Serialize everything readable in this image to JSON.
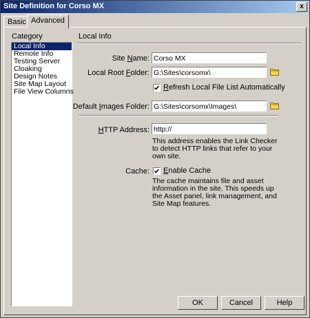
{
  "window": {
    "title": "Site Definition for Corso MX",
    "close_label": "x"
  },
  "tabs": [
    {
      "label": "Basic"
    },
    {
      "label": "Advanced"
    }
  ],
  "category": {
    "label": "Category",
    "items": [
      "Local Info",
      "Remote Info",
      "Testing Server",
      "Cloaking",
      "Design Notes",
      "Site Map Layout",
      "File View Columns"
    ],
    "selected": "Local Info"
  },
  "local_info": {
    "title": "Local Info",
    "site_name": {
      "label": "Site Name:",
      "value": "Corso MX"
    },
    "local_root": {
      "label": "Local Root Folder:",
      "value": "G:\\Sites\\corsomx\\"
    },
    "refresh": {
      "label": "Refresh Local File List Automatically",
      "checked": true
    },
    "images_folder": {
      "label": "Default Images Folder:",
      "value": "G:\\Sites\\corsomx\\Images\\"
    },
    "http_address": {
      "label": "HTTP Address:",
      "value": "http://",
      "description": "This address enables the Link Checker to detect HTTP links that refer to your own site."
    },
    "cache": {
      "label": "Cache:",
      "checkbox_label": "Enable Cache",
      "checked": true,
      "description": "The cache maintains file and asset information in the site.  This speeds up the Asset panel, link management, and Site Map features."
    }
  },
  "buttons": {
    "ok": "OK",
    "cancel": "Cancel",
    "help": "Help"
  }
}
